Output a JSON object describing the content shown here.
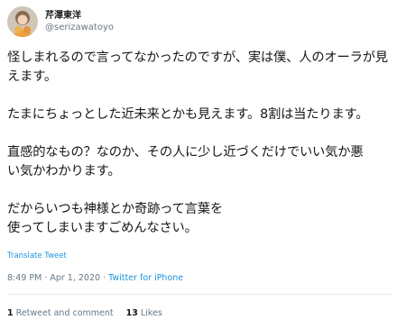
{
  "tweet": {
    "display_name": "芹澤東洋",
    "handle": "@serizawatoyo",
    "lines": [
      "怪しまれるので言ってなかったのですが、実は僕、人のオーラが見",
      "えます。",
      "",
      "たまにちょっとした近未来とかも見えます。8割は当たります。",
      "",
      "直感的なもの？なのか、その人に少し近づくだけでいい気か悪",
      "い気かわかります。",
      "",
      "だからいつも神様とか奇跡って言葉を",
      "使ってしまいますごめんなさい。"
    ],
    "translate_label": "Translate Tweet",
    "timestamp": "8:49 PM · Apr 1, 2020 · ",
    "source": "Twitter for iPhone",
    "retweets_count": "1",
    "retweets_label": "Retweet and comment",
    "likes_count": "13",
    "likes_label": "Likes"
  }
}
